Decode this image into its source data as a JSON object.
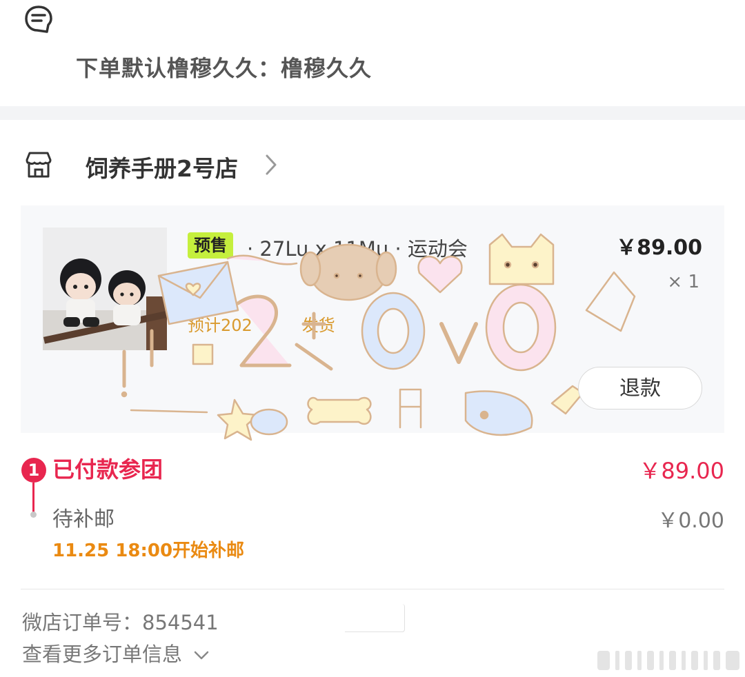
{
  "note": {
    "icon": "note-bubble-icon",
    "text": "下单默认橹穆久久：橹穆久久"
  },
  "shop": {
    "icon": "store-icon",
    "name": "饲养手册2号店",
    "chevron": "chevron-right-icon"
  },
  "product": {
    "image": "plush-dolls-photo",
    "badge": "预售",
    "title": "· 27Lu x 11Mu · 运动会",
    "price": "￥89.00",
    "quantity": "× 1",
    "ship_estimate": "预计202",
    "ship_estimate_tail": "发货",
    "refund_label": "退款"
  },
  "sticker": {
    "text": "小2+OvO",
    "colors": {
      "outline": "#d9b48f",
      "blue": "#dce8fb",
      "pink": "#fbe3ee",
      "yellow": "#fdf3c9"
    }
  },
  "status": {
    "step_number": "1",
    "paid_label": "已付款参团",
    "paid_amount": "￥89.00",
    "pending_label": "待补邮",
    "pending_amount": "￥0.00",
    "supplement_time": "11.25 18:00开始补邮"
  },
  "order": {
    "number_text": "微店订单号：854541",
    "more_label": "查看更多订单信息",
    "more_icon": "chevron-down-icon"
  },
  "colors": {
    "accent_red": "#e8264f",
    "badge_green": "#c5ef3d",
    "warning_orange": "#ea8a12",
    "band_gray": "#f3f4f6"
  }
}
